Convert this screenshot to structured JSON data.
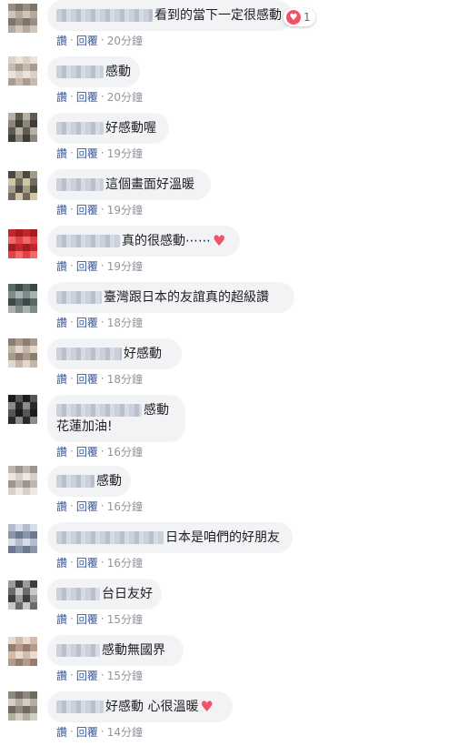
{
  "actions": {
    "like": "讚",
    "reply": "回覆",
    "separator": "·"
  },
  "colors": {
    "link": "#385898",
    "time": "#90949c",
    "bubble": "#f2f3f5",
    "heart": "#f25268"
  },
  "comments": [
    {
      "text": "看到的當下一定很感動",
      "heart": "",
      "text2": "",
      "time": "20分鐘",
      "reaction_count": "1"
    },
    {
      "text": "感動",
      "heart": "",
      "text2": "",
      "time": "20分鐘",
      "reaction_count": ""
    },
    {
      "text": "好感動喔",
      "heart": "",
      "text2": "",
      "time": "19分鐘",
      "reaction_count": ""
    },
    {
      "text": "這個畫面好溫暖",
      "heart": "",
      "text2": "",
      "time": "19分鐘",
      "reaction_count": ""
    },
    {
      "text": "真的很感動⋯⋯",
      "heart": "♥",
      "text2": "",
      "time": "19分鐘",
      "reaction_count": ""
    },
    {
      "text": "臺灣跟日本的友誼真的超級讚",
      "heart": "",
      "text2": "",
      "time": "18分鐘",
      "reaction_count": ""
    },
    {
      "text": "好感動",
      "heart": "",
      "text2": "",
      "time": "18分鐘",
      "reaction_count": ""
    },
    {
      "text": "感動",
      "heart": "",
      "text2": "花蓮加油!",
      "time": "16分鐘",
      "reaction_count": ""
    },
    {
      "text": "感動",
      "heart": "",
      "text2": "",
      "time": "16分鐘",
      "reaction_count": ""
    },
    {
      "text": "日本是咱們的好朋友",
      "heart": "",
      "text2": "",
      "time": "16分鐘",
      "reaction_count": ""
    },
    {
      "text": "台日友好",
      "heart": "",
      "text2": "",
      "time": "15分鐘",
      "reaction_count": ""
    },
    {
      "text": "感動無國界",
      "heart": "",
      "text2": "",
      "time": "15分鐘",
      "reaction_count": ""
    },
    {
      "text": "好感動 心很溫暖",
      "heart": "♥",
      "text2": "",
      "time": "14分鐘",
      "reaction_count": ""
    }
  ]
}
